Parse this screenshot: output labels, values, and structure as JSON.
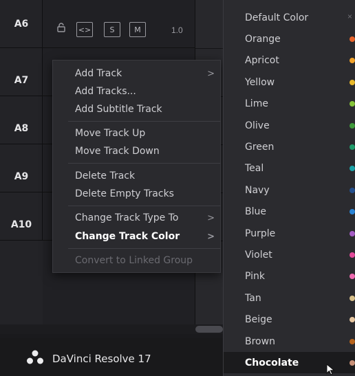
{
  "tracks": [
    {
      "name": "A6"
    },
    {
      "name": "A7"
    },
    {
      "name": "A8"
    },
    {
      "name": "A9"
    },
    {
      "name": "A10"
    }
  ],
  "track_controls": {
    "btn_swap": "<>",
    "btn_solo": "S",
    "btn_mute": "M",
    "volume": "1.0"
  },
  "app": {
    "title": "DaVinci Resolve 17",
    "logo_icon": "davinci-resolve-logo-icon"
  },
  "context_menu": {
    "items": [
      {
        "label": "Add Track",
        "submenu": true
      },
      {
        "label": "Add Tracks..."
      },
      {
        "label": "Add Subtitle Track"
      },
      {
        "label": "Move Track Up"
      },
      {
        "label": "Move Track Down"
      },
      {
        "label": "Delete Track"
      },
      {
        "label": "Delete Empty Tracks"
      },
      {
        "label": "Change Track Type To",
        "submenu": true
      },
      {
        "label": "Change Track Color",
        "submenu": true,
        "active": true
      },
      {
        "label": "Convert to Linked Group",
        "disabled": true
      }
    ],
    "arrow": ">"
  },
  "color_menu": {
    "close": "×",
    "items": [
      {
        "label": "Default Color",
        "color": null
      },
      {
        "label": "Orange",
        "color": "#e8632a"
      },
      {
        "label": "Apricot",
        "color": "#f2a32a"
      },
      {
        "label": "Yellow",
        "color": "#e9b92a"
      },
      {
        "label": "Lime",
        "color": "#86c43a"
      },
      {
        "label": "Olive",
        "color": "#3f9a3a"
      },
      {
        "label": "Green",
        "color": "#1f9c6a"
      },
      {
        "label": "Teal",
        "color": "#1aa3a8"
      },
      {
        "label": "Navy",
        "color": "#24508e"
      },
      {
        "label": "Blue",
        "color": "#2a84d6"
      },
      {
        "label": "Purple",
        "color": "#a45cc4"
      },
      {
        "label": "Violet",
        "color": "#e24a9a"
      },
      {
        "label": "Pink",
        "color": "#ee6ab0"
      },
      {
        "label": "Tan",
        "color": "#d8c08a"
      },
      {
        "label": "Beige",
        "color": "#e6c6a0"
      },
      {
        "label": "Brown",
        "color": "#b8641c"
      },
      {
        "label": "Chocolate",
        "color": "#c89078",
        "selected": true
      }
    ]
  }
}
